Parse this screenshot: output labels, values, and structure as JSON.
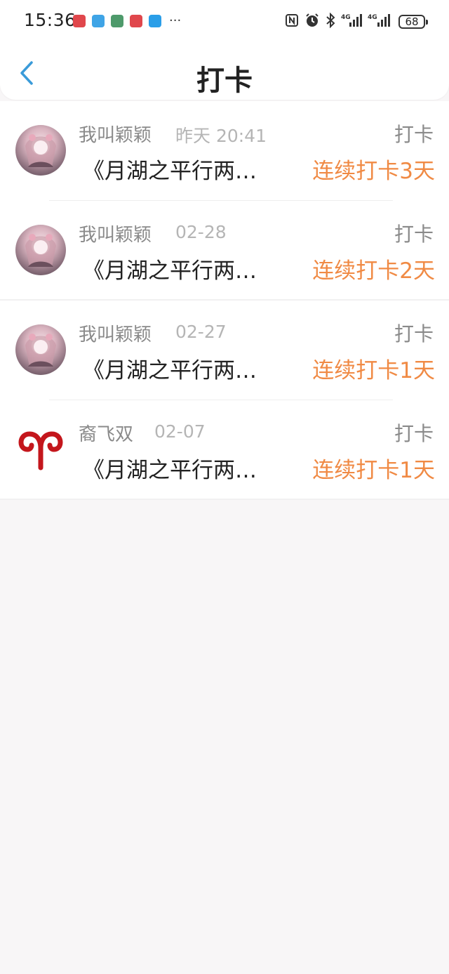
{
  "status_bar": {
    "time": "15:36",
    "more": "···",
    "battery": "68",
    "network_1": "4G",
    "network_2": "4G"
  },
  "header": {
    "title": "打卡"
  },
  "colors": {
    "accent_back": "#3a9bd9",
    "streak_orange": "#f08a44",
    "name_gray": "#8a8a8a",
    "time_gray": "#b5b5b5"
  },
  "items": [
    {
      "name": "我叫颖颖",
      "time": "昨天 20:41",
      "type": "打卡",
      "book": "《月湖之平行两…",
      "streak": "连续打卡3天",
      "avatar": "anime-girl-avatar"
    },
    {
      "name": "我叫颖颖",
      "time": "02-28",
      "type": "打卡",
      "book": "《月湖之平行两…",
      "streak": "连续打卡2天",
      "avatar": "anime-girl-avatar"
    },
    {
      "name": "我叫颖颖",
      "time": "02-27",
      "type": "打卡",
      "book": "《月湖之平行两…",
      "streak": "连续打卡1天",
      "avatar": "anime-girl-avatar"
    },
    {
      "name": "裔飞双",
      "time": "02-07",
      "type": "打卡",
      "book": "《月湖之平行两…",
      "streak": "连续打卡1天",
      "avatar": "aries-symbol-avatar"
    }
  ]
}
